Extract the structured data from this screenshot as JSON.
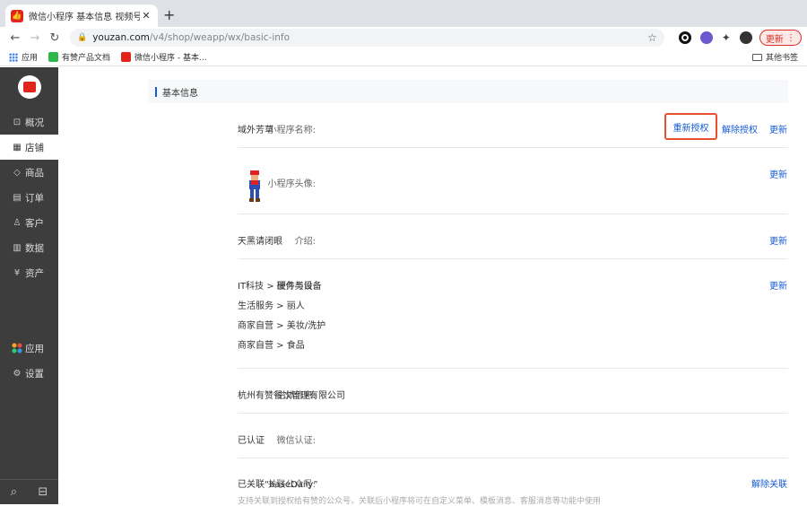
{
  "browser": {
    "tab_title": "微信小程序  基本信息  视频号",
    "tab_close": "✕",
    "new_tab": "+",
    "url_host": "youzan.com",
    "url_path": "/v4/shop/weapp/wx/basic-info",
    "update_label": "更新",
    "bookmarks": [
      "应用",
      "有赞产品文档",
      "微信小程序 - 基本..."
    ],
    "other_bookmarks": "其他书签",
    "accent": "#d93025"
  },
  "sidebar": {
    "items": [
      {
        "icon": "⊡",
        "label": "概况"
      },
      {
        "icon": "▦",
        "label": "店铺"
      },
      {
        "icon": "◇",
        "label": "商品"
      },
      {
        "icon": "▤",
        "label": "订单"
      },
      {
        "icon": "♙",
        "label": "客户"
      },
      {
        "icon": "▥",
        "label": "数据"
      },
      {
        "icon": "¥",
        "label": "资产"
      }
    ],
    "lower_items": [
      {
        "label": "应用"
      },
      {
        "icon": "⚙",
        "label": "设置"
      }
    ],
    "active_color": "#ffffff",
    "bg_color": "#3d3d3d"
  },
  "section": {
    "title": "基本信息"
  },
  "rows": {
    "name": {
      "label": "小程序名称:",
      "value": "域外芳草",
      "reauth": "重新授权",
      "unauth": "解除授权",
      "update": "更新"
    },
    "avatar": {
      "label": "小程序头像:",
      "update": "更新"
    },
    "intro": {
      "label": "介绍:",
      "value": "天黑请闭眼",
      "update": "更新"
    },
    "category": {
      "label": "服务类目:",
      "values": [
        "IT科技 > 硬件与设备",
        "生活服务 > 丽人",
        "商家自营 > 美妆/洗护",
        "商家自营 > 食品"
      ],
      "update": "更新"
    },
    "entity": {
      "label": "主体信息:",
      "value": "杭州有赞餐饮管理有限公司"
    },
    "verify": {
      "label": "微信认证:",
      "value": "已认证"
    },
    "official": {
      "label": "关联公众号:",
      "value": "已关联“baseDaily”",
      "unlink": "解除关联",
      "hint": "支持关联到授权给有赞的公众号，关联后小程序将可在自定义菜单、模板消息、客服消息等功能中使用"
    }
  },
  "colors": {
    "link": "#155bd4",
    "highlight_border": "#e8502e"
  }
}
